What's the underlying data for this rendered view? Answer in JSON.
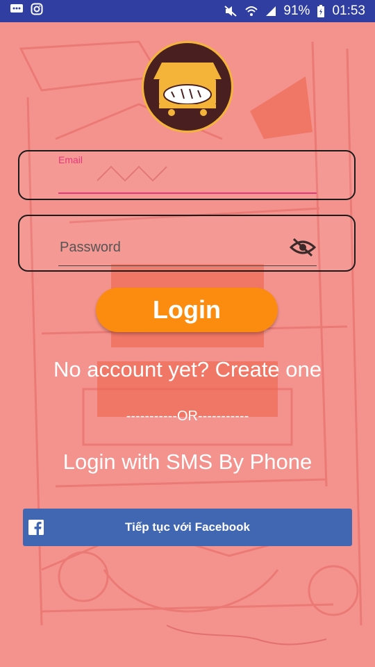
{
  "status_bar": {
    "battery": "91%",
    "time": "01:53",
    "icons": [
      "message-icon",
      "instagram-icon",
      "mute-icon",
      "wifi-icon",
      "signal-icon",
      "battery-charging-icon"
    ]
  },
  "logo": {
    "name": "bakery-cart-logo"
  },
  "email": {
    "label": "Email",
    "value": ""
  },
  "password": {
    "placeholder": "Password",
    "toggle_icon": "eye-off-icon"
  },
  "login_button": "Login",
  "create_account": "No account yet? Create one",
  "or_divider": "-----------OR-----------",
  "sms_login": "Login with SMS By Phone",
  "facebook_button": "Tiếp tục với Facebook",
  "colors": {
    "status_bar": "#2f3ea0",
    "background": "#f4938e",
    "accent_pink": "#e8377a",
    "login_orange": "#fb8c10",
    "facebook_blue": "#4267b2",
    "logo_brown": "#4a1f1f",
    "logo_gold": "#f4b43a"
  }
}
